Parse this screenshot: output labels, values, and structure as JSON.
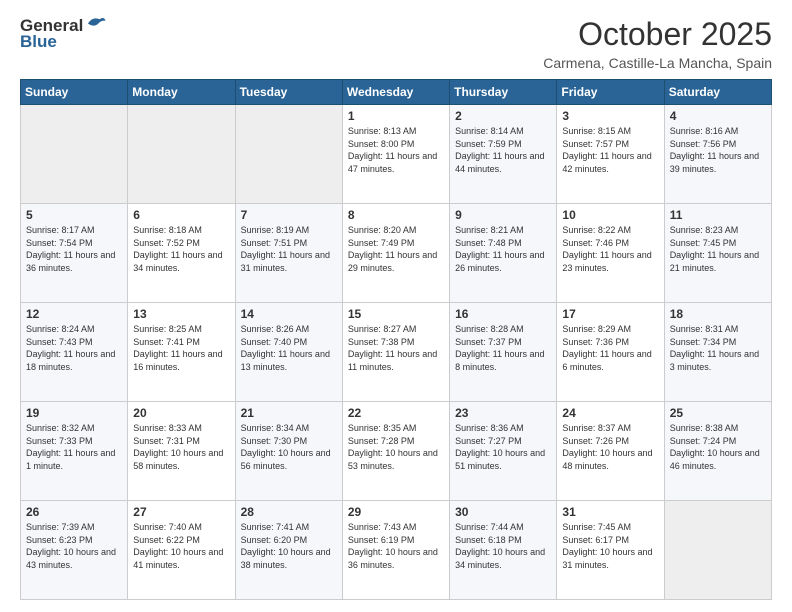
{
  "header": {
    "logo_general": "General",
    "logo_blue": "Blue",
    "month_title": "October 2025",
    "location": "Carmena, Castille-La Mancha, Spain"
  },
  "days_of_week": [
    "Sunday",
    "Monday",
    "Tuesday",
    "Wednesday",
    "Thursday",
    "Friday",
    "Saturday"
  ],
  "weeks": [
    [
      {
        "day": "",
        "sunrise": "",
        "sunset": "",
        "daylight": ""
      },
      {
        "day": "",
        "sunrise": "",
        "sunset": "",
        "daylight": ""
      },
      {
        "day": "",
        "sunrise": "",
        "sunset": "",
        "daylight": ""
      },
      {
        "day": "1",
        "sunrise": "Sunrise: 8:13 AM",
        "sunset": "Sunset: 8:00 PM",
        "daylight": "Daylight: 11 hours and 47 minutes."
      },
      {
        "day": "2",
        "sunrise": "Sunrise: 8:14 AM",
        "sunset": "Sunset: 7:59 PM",
        "daylight": "Daylight: 11 hours and 44 minutes."
      },
      {
        "day": "3",
        "sunrise": "Sunrise: 8:15 AM",
        "sunset": "Sunset: 7:57 PM",
        "daylight": "Daylight: 11 hours and 42 minutes."
      },
      {
        "day": "4",
        "sunrise": "Sunrise: 8:16 AM",
        "sunset": "Sunset: 7:56 PM",
        "daylight": "Daylight: 11 hours and 39 minutes."
      }
    ],
    [
      {
        "day": "5",
        "sunrise": "Sunrise: 8:17 AM",
        "sunset": "Sunset: 7:54 PM",
        "daylight": "Daylight: 11 hours and 36 minutes."
      },
      {
        "day": "6",
        "sunrise": "Sunrise: 8:18 AM",
        "sunset": "Sunset: 7:52 PM",
        "daylight": "Daylight: 11 hours and 34 minutes."
      },
      {
        "day": "7",
        "sunrise": "Sunrise: 8:19 AM",
        "sunset": "Sunset: 7:51 PM",
        "daylight": "Daylight: 11 hours and 31 minutes."
      },
      {
        "day": "8",
        "sunrise": "Sunrise: 8:20 AM",
        "sunset": "Sunset: 7:49 PM",
        "daylight": "Daylight: 11 hours and 29 minutes."
      },
      {
        "day": "9",
        "sunrise": "Sunrise: 8:21 AM",
        "sunset": "Sunset: 7:48 PM",
        "daylight": "Daylight: 11 hours and 26 minutes."
      },
      {
        "day": "10",
        "sunrise": "Sunrise: 8:22 AM",
        "sunset": "Sunset: 7:46 PM",
        "daylight": "Daylight: 11 hours and 23 minutes."
      },
      {
        "day": "11",
        "sunrise": "Sunrise: 8:23 AM",
        "sunset": "Sunset: 7:45 PM",
        "daylight": "Daylight: 11 hours and 21 minutes."
      }
    ],
    [
      {
        "day": "12",
        "sunrise": "Sunrise: 8:24 AM",
        "sunset": "Sunset: 7:43 PM",
        "daylight": "Daylight: 11 hours and 18 minutes."
      },
      {
        "day": "13",
        "sunrise": "Sunrise: 8:25 AM",
        "sunset": "Sunset: 7:41 PM",
        "daylight": "Daylight: 11 hours and 16 minutes."
      },
      {
        "day": "14",
        "sunrise": "Sunrise: 8:26 AM",
        "sunset": "Sunset: 7:40 PM",
        "daylight": "Daylight: 11 hours and 13 minutes."
      },
      {
        "day": "15",
        "sunrise": "Sunrise: 8:27 AM",
        "sunset": "Sunset: 7:38 PM",
        "daylight": "Daylight: 11 hours and 11 minutes."
      },
      {
        "day": "16",
        "sunrise": "Sunrise: 8:28 AM",
        "sunset": "Sunset: 7:37 PM",
        "daylight": "Daylight: 11 hours and 8 minutes."
      },
      {
        "day": "17",
        "sunrise": "Sunrise: 8:29 AM",
        "sunset": "Sunset: 7:36 PM",
        "daylight": "Daylight: 11 hours and 6 minutes."
      },
      {
        "day": "18",
        "sunrise": "Sunrise: 8:31 AM",
        "sunset": "Sunset: 7:34 PM",
        "daylight": "Daylight: 11 hours and 3 minutes."
      }
    ],
    [
      {
        "day": "19",
        "sunrise": "Sunrise: 8:32 AM",
        "sunset": "Sunset: 7:33 PM",
        "daylight": "Daylight: 11 hours and 1 minute."
      },
      {
        "day": "20",
        "sunrise": "Sunrise: 8:33 AM",
        "sunset": "Sunset: 7:31 PM",
        "daylight": "Daylight: 10 hours and 58 minutes."
      },
      {
        "day": "21",
        "sunrise": "Sunrise: 8:34 AM",
        "sunset": "Sunset: 7:30 PM",
        "daylight": "Daylight: 10 hours and 56 minutes."
      },
      {
        "day": "22",
        "sunrise": "Sunrise: 8:35 AM",
        "sunset": "Sunset: 7:28 PM",
        "daylight": "Daylight: 10 hours and 53 minutes."
      },
      {
        "day": "23",
        "sunrise": "Sunrise: 8:36 AM",
        "sunset": "Sunset: 7:27 PM",
        "daylight": "Daylight: 10 hours and 51 minutes."
      },
      {
        "day": "24",
        "sunrise": "Sunrise: 8:37 AM",
        "sunset": "Sunset: 7:26 PM",
        "daylight": "Daylight: 10 hours and 48 minutes."
      },
      {
        "day": "25",
        "sunrise": "Sunrise: 8:38 AM",
        "sunset": "Sunset: 7:24 PM",
        "daylight": "Daylight: 10 hours and 46 minutes."
      }
    ],
    [
      {
        "day": "26",
        "sunrise": "Sunrise: 7:39 AM",
        "sunset": "Sunset: 6:23 PM",
        "daylight": "Daylight: 10 hours and 43 minutes."
      },
      {
        "day": "27",
        "sunrise": "Sunrise: 7:40 AM",
        "sunset": "Sunset: 6:22 PM",
        "daylight": "Daylight: 10 hours and 41 minutes."
      },
      {
        "day": "28",
        "sunrise": "Sunrise: 7:41 AM",
        "sunset": "Sunset: 6:20 PM",
        "daylight": "Daylight: 10 hours and 38 minutes."
      },
      {
        "day": "29",
        "sunrise": "Sunrise: 7:43 AM",
        "sunset": "Sunset: 6:19 PM",
        "daylight": "Daylight: 10 hours and 36 minutes."
      },
      {
        "day": "30",
        "sunrise": "Sunrise: 7:44 AM",
        "sunset": "Sunset: 6:18 PM",
        "daylight": "Daylight: 10 hours and 34 minutes."
      },
      {
        "day": "31",
        "sunrise": "Sunrise: 7:45 AM",
        "sunset": "Sunset: 6:17 PM",
        "daylight": "Daylight: 10 hours and 31 minutes."
      },
      {
        "day": "",
        "sunrise": "",
        "sunset": "",
        "daylight": ""
      }
    ]
  ]
}
